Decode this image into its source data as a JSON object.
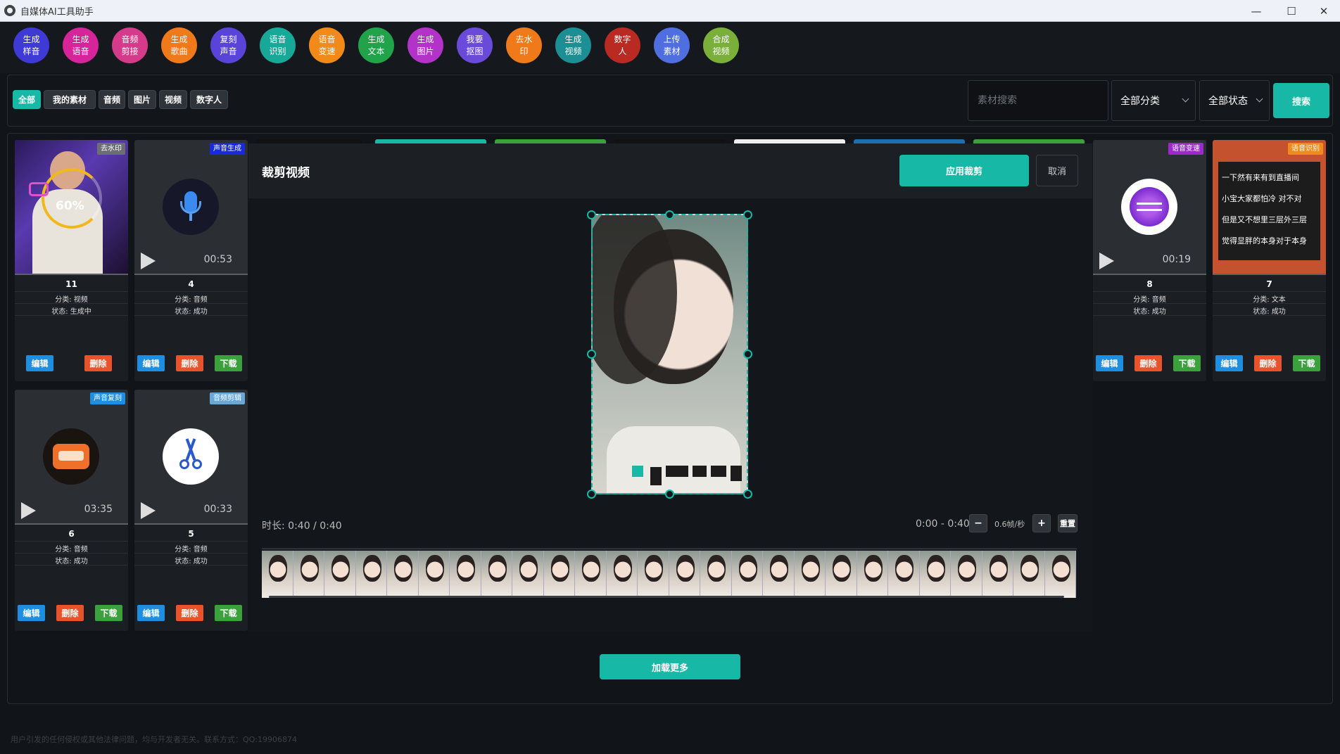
{
  "window": {
    "title": "自媒体AI工具助手",
    "minimize": "—",
    "maximize": "☐",
    "close": "✕"
  },
  "tools": [
    {
      "label": "生成\n样音",
      "color": "#3f3ad6"
    },
    {
      "label": "生成\n语音",
      "color": "#d6249a"
    },
    {
      "label": "音频\n剪接",
      "color": "#d63a8a"
    },
    {
      "label": "生成\n歌曲",
      "color": "#f07a1a"
    },
    {
      "label": "复刻\n声音",
      "color": "#5a44d8"
    },
    {
      "label": "语音\n识别",
      "color": "#18a897"
    },
    {
      "label": "语音\n变速",
      "color": "#f28a1a"
    },
    {
      "label": "生成\n文本",
      "color": "#21a34a"
    },
    {
      "label": "生成\n图片",
      "color": "#b333c9"
    },
    {
      "label": "我要\n抠图",
      "color": "#6a4ad8"
    },
    {
      "label": "去水\n印",
      "color": "#f07a1a"
    },
    {
      "label": "生成\n视频",
      "color": "#1b8f94"
    },
    {
      "label": "数字\n人",
      "color": "#b82a22"
    },
    {
      "label": "上传\n素材",
      "color": "#4f6fe0"
    },
    {
      "label": "合成\n视频",
      "color": "#7ab03a"
    }
  ],
  "filters": {
    "tabs": [
      "全部",
      "我的素材",
      "音频",
      "图片",
      "视频",
      "数字人"
    ],
    "active": "全部",
    "search_placeholder": "素材搜索",
    "category": "全部分类",
    "status": "全部状态",
    "search_button": "搜索"
  },
  "cards": [
    {
      "id": "11",
      "badge": "去水印",
      "badge_color": "#6b6f75",
      "category": "分类: 视频",
      "status": "状态: 生成中",
      "duration": "",
      "buttons": [
        "编辑",
        "删除"
      ],
      "overlay": "60%"
    },
    {
      "id": "4",
      "badge": "声音生成",
      "badge_color": "#1a2ad8",
      "category": "分类: 音频",
      "status": "状态: 成功",
      "duration": "00:53",
      "buttons": [
        "编辑",
        "删除",
        "下载"
      ]
    },
    {
      "id": "6",
      "badge": "声音复刻",
      "badge_color": "#1e8fe0",
      "category": "分类: 音频",
      "status": "状态: 成功",
      "duration": "03:35",
      "buttons": [
        "编辑",
        "删除",
        "下载"
      ]
    },
    {
      "id": "5",
      "badge": "音频剪辑",
      "badge_color": "#6aa8d8",
      "category": "分类: 音频",
      "status": "状态: 成功",
      "duration": "00:33",
      "buttons": [
        "编辑",
        "删除",
        "下载"
      ]
    },
    {
      "id": "8",
      "badge": "语音变速",
      "badge_color": "#9b2ac9",
      "category": "分类: 音频",
      "status": "状态: 成功",
      "duration": "00:19",
      "buttons": [
        "编辑",
        "删除",
        "下载"
      ]
    },
    {
      "id": "7",
      "badge": "语音识别",
      "badge_color": "#f08a1a",
      "category": "分类: 文本",
      "status": "状态: 成功",
      "duration": "",
      "buttons": [
        "编辑",
        "删除",
        "下载"
      ],
      "text_lines": [
        "一下然有来有到直播间",
        "小宝大家都怕冷 对不对",
        "但是又不想里三层外三层",
        "觉得显胖的本身对于本身"
      ]
    }
  ],
  "modal": {
    "title": "裁剪视频",
    "apply_button": "应用裁剪",
    "cancel_button": "取消",
    "duration_text": "时长: 0:40 / 0:40",
    "range_text": "0:00 - 0:40",
    "minus": "−",
    "fps": "0.6帧/秒",
    "plus": "+",
    "reset": "重置"
  },
  "load_more": "加载更多",
  "footer": "用户引发的任何侵权或其他法律问题，均与开发者无关。联系方式：QQ:19906874"
}
